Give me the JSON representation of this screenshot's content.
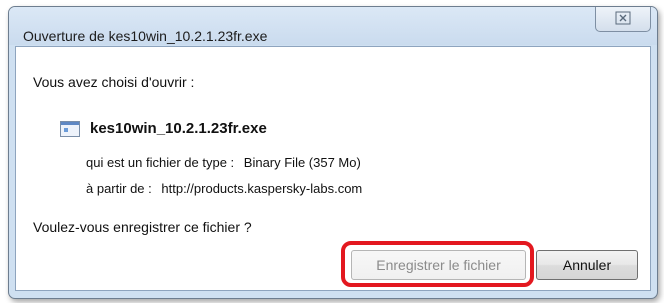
{
  "window": {
    "title": "Ouverture de kes10win_10.2.1.23fr.exe",
    "close_glyph": "☒"
  },
  "dialog": {
    "prompt": "Vous avez choisi d'ouvrir :",
    "file": {
      "icon": "executable-file-icon",
      "name": "kes10win_10.2.1.23fr.exe"
    },
    "type_label": "qui est un fichier de type :",
    "type_value": "Binary File (357 Mo)",
    "source_label": "à partir de :",
    "source_value": "http://products.kaspersky-labs.com",
    "question": "Voulez-vous enregistrer ce fichier ?"
  },
  "buttons": {
    "save_label": "Enregistrer le fichier",
    "cancel_label": "Annuler"
  },
  "colors": {
    "highlight": "#e3181f",
    "frame": "#cfe0f1"
  }
}
